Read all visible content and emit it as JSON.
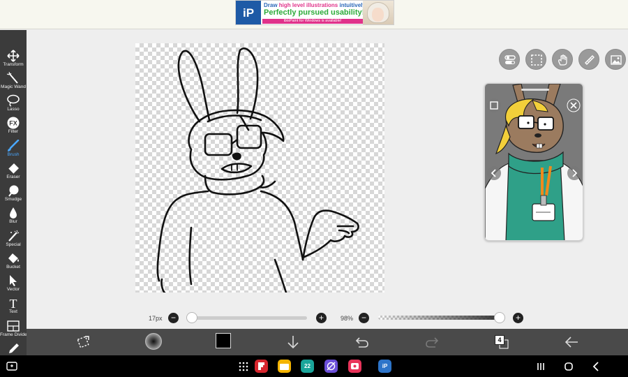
{
  "ad": {
    "line1_pre": "Draw ",
    "line1_highlight": "high level illustrations",
    "line1_post": " intuitively!",
    "line2": "Perfectly pursued usability!",
    "strip": "ibisPaint for Windows is available!",
    "logo_text": "iP"
  },
  "toolbar": {
    "items": [
      {
        "label": "Transform",
        "icon": "transform-icon",
        "active": false
      },
      {
        "label": "Magic Wand",
        "icon": "magic-wand-icon",
        "active": false
      },
      {
        "label": "Lasso",
        "icon": "lasso-icon",
        "active": false
      },
      {
        "label": "Filter",
        "icon": "filter-icon",
        "active": false
      },
      {
        "label": "Brush",
        "icon": "brush-icon",
        "active": true
      },
      {
        "label": "Eraser",
        "icon": "eraser-icon",
        "active": false
      },
      {
        "label": "Smudge",
        "icon": "smudge-icon",
        "active": false
      },
      {
        "label": "Blur",
        "icon": "blur-icon",
        "active": false
      },
      {
        "label": "Special",
        "icon": "special-icon",
        "active": false
      },
      {
        "label": "Bucket",
        "icon": "bucket-icon",
        "active": false
      },
      {
        "label": "Vector",
        "icon": "vector-icon",
        "active": false
      },
      {
        "label": "Text",
        "icon": "text-icon",
        "active": false
      },
      {
        "label": "Frame Divider",
        "icon": "frame-divider-icon",
        "active": false
      },
      {
        "label": "",
        "icon": "eyedropper-icon",
        "active": false
      }
    ],
    "filter_glyph": "FX",
    "text_glyph": "T"
  },
  "brush": {
    "size_label": "17px",
    "size_fraction": 0.03,
    "opacity_label": "98%",
    "opacity_fraction": 0.98,
    "minus": "−",
    "plus": "+"
  },
  "bottombar": {
    "color": "#000000",
    "layer_count": "4"
  },
  "reference": {
    "close_glyph": "×",
    "prev_glyph": "‹",
    "next_glyph": "›"
  },
  "navbar": {
    "apps": [
      {
        "name": "flipboard-app",
        "color": "#d7262e",
        "glyph": ""
      },
      {
        "name": "files-app",
        "color": "#f4b400",
        "glyph": ""
      },
      {
        "name": "calendar-app",
        "color": "#1aa59a",
        "glyph": "22"
      },
      {
        "name": "internet-app",
        "color": "#6b4fd8",
        "glyph": ""
      },
      {
        "name": "screen-recorder-app",
        "color": "#e8335a",
        "glyph": ""
      },
      {
        "name": "ibispaint-app",
        "color": "#2d74c9",
        "glyph": "iP"
      }
    ]
  },
  "colors": {
    "toolbar_bg": "#3b3b3b",
    "accent": "#4aa8ff",
    "bottombar_bg": "#4a4a4a"
  }
}
